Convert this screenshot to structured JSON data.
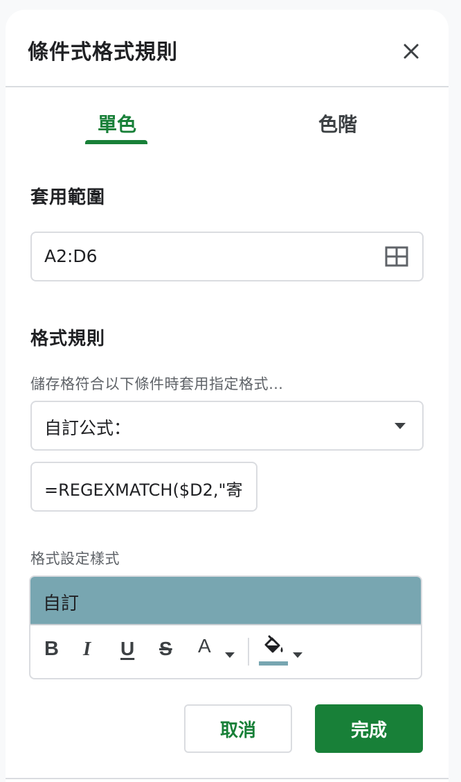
{
  "dialog": {
    "title": "條件式格式規則"
  },
  "tabs": [
    {
      "label": "單色",
      "active": true
    },
    {
      "label": "色階",
      "active": false
    }
  ],
  "range": {
    "label": "套用範圍",
    "value": "A2:D6"
  },
  "rules": {
    "label": "格式規則",
    "hint": "儲存格符合以下條件時套用指定格式…",
    "condition_selected": "自訂公式：",
    "formula_value": "=REGEXMATCH($D2,\"寄"
  },
  "style": {
    "label": "格式設定樣式",
    "preset": "自訂",
    "preview_fill": "#78a6b1",
    "toolbar": {
      "bold": "B",
      "italic": "I",
      "underline": "U",
      "strikethrough": "S",
      "text_color": "A",
      "text_color_icon": "text-color-icon",
      "fill_color_icon": "fill-color-icon"
    }
  },
  "buttons": {
    "cancel": "取消",
    "done": "完成"
  },
  "colors": {
    "accent": "#188038",
    "fill_swatch": "#78a6b1"
  }
}
